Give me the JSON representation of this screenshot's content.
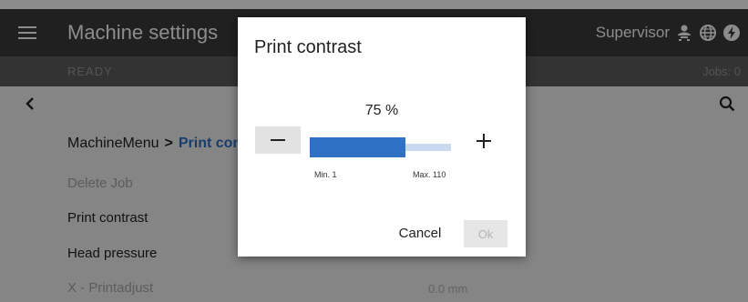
{
  "header": {
    "title": "Machine settings",
    "user_role": "Supervisor"
  },
  "statusbar": {
    "status": "READY",
    "jobs": "Jobs: 0"
  },
  "breadcrumb": {
    "root": "MachineMenu",
    "separator": ">",
    "current": "Print contrast"
  },
  "menu": {
    "items": [
      {
        "label": "Delete Job",
        "enabled": false,
        "value": ""
      },
      {
        "label": "Print contrast",
        "enabled": true,
        "value": ""
      },
      {
        "label": "Head pressure",
        "enabled": true,
        "value": ""
      },
      {
        "label": "X - Printadjust",
        "enabled": false,
        "value": "0.0 mm"
      }
    ]
  },
  "dialog": {
    "title": "Print contrast",
    "value": 75,
    "value_text": "75 %",
    "min": 1,
    "max": 110,
    "min_label": "Min. 1",
    "max_label": "Max. 110",
    "minus_label": "−",
    "plus_label": "+",
    "cancel_label": "Cancel",
    "ok_label": "Ok"
  },
  "icons": {
    "menu": "hamburger-icon",
    "user": "supervisor-user-icon",
    "language": "globe-icon",
    "power": "power-icon",
    "back": "chevron-left-icon",
    "search": "search-icon"
  },
  "colors": {
    "accent": "#2f72c4",
    "header_bg": "#3b3b3b",
    "statusbar_bg": "#5e5e5e"
  }
}
